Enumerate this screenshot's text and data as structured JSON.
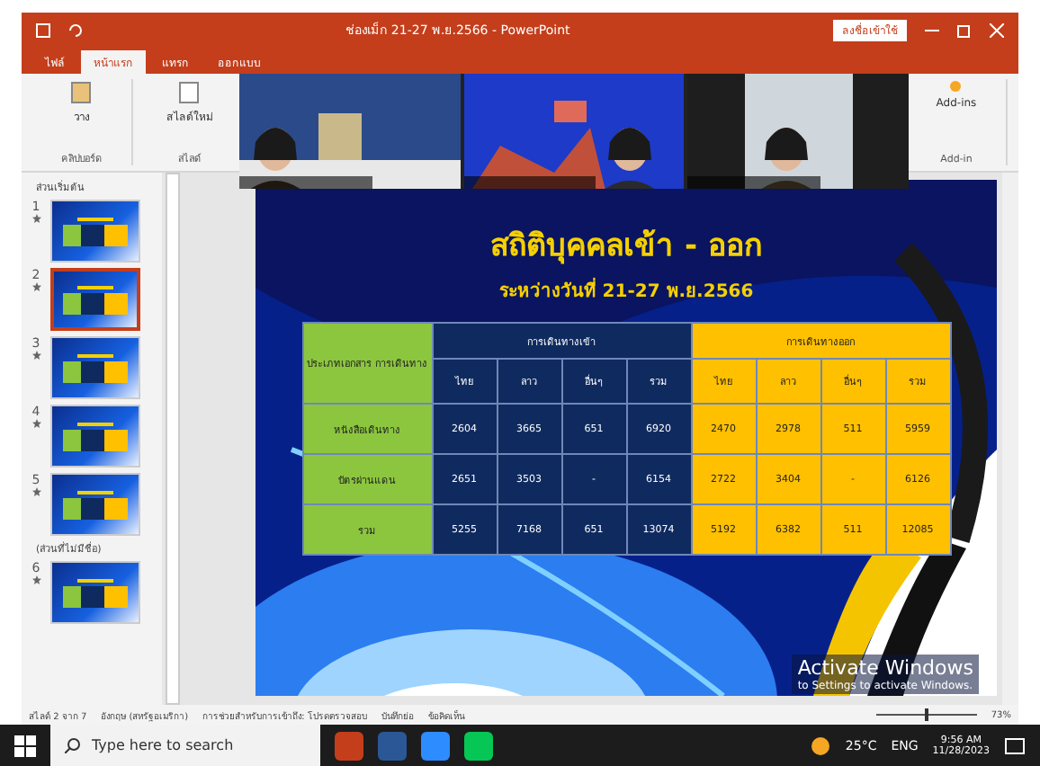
{
  "window": {
    "title": "ช่องเม็ก 21-27 พ.ย.2566  -  PowerPoint",
    "signin_button": "ลงชื่อเข้าใช้"
  },
  "ribbon": {
    "tabs": [
      {
        "label": "ไฟล์",
        "selected": false
      },
      {
        "label": "หน้าแรก",
        "selected": true
      },
      {
        "label": "แทรก",
        "selected": false
      },
      {
        "label": "ออกแบบ",
        "selected": false
      }
    ],
    "groups": [
      {
        "label": "คลิปบอร์ด",
        "button": "วาง"
      },
      {
        "label": "สไลด์",
        "button": "สไลด์ใหม่"
      }
    ],
    "addins": {
      "button": "Add-ins",
      "label": "Add-in"
    }
  },
  "slides_panel": {
    "sections": [
      {
        "title": "ส่วนเริ่มต้น",
        "slides": [
          {
            "number": "1",
            "selected": false
          },
          {
            "number": "2",
            "selected": true
          },
          {
            "number": "3",
            "selected": false
          },
          {
            "number": "4",
            "selected": false
          },
          {
            "number": "5",
            "selected": false
          }
        ]
      },
      {
        "title": "(ส่วนที่ไม่มีชื่อ)",
        "slides": [
          {
            "number": "6",
            "selected": false
          }
        ]
      }
    ]
  },
  "slide": {
    "title": "สถิติบุคคลเข้า - ออก",
    "subtitle": "ระหว่างวันที่ 21-27 พ.ย.2566",
    "table": {
      "corner": "ประเภทเอกสาร การเดินทาง",
      "groups": [
        {
          "label": "การเดินทางเข้า",
          "color": "#0f2a5e",
          "columns": [
            "ไทย",
            "ลาว",
            "อื่นๆ",
            "รวม"
          ]
        },
        {
          "label": "การเดินทางออก",
          "color": "#ffc000",
          "columns": [
            "ไทย",
            "ลาว",
            "อื่นๆ",
            "รวม"
          ]
        }
      ],
      "rows": [
        {
          "label": "หนังสือเดินทาง",
          "cells": [
            "2604",
            "3665",
            "651",
            "6920",
            "2470",
            "2978",
            "511",
            "5959"
          ]
        },
        {
          "label": "บัตรผ่านแดน",
          "cells": [
            "2651",
            "3503",
            "-",
            "6154",
            "2722",
            "3404",
            "-",
            "6126"
          ]
        },
        {
          "label": "รวม",
          "cells": [
            "5255",
            "7168",
            "651",
            "13074",
            "5192",
            "6382",
            "511",
            "12085"
          ]
        }
      ]
    }
  },
  "activation": {
    "title": "Activate Windows",
    "message": "to Settings to activate Windows."
  },
  "status_bar": {
    "slide_info": "สไลด์ 2 จาก 7",
    "language": "อังกฤษ (สหรัฐอเมริกา)",
    "accessibility": "การช่วยสำหรับการเข้าถึง: โปรดตรวจสอบ",
    "notes": "บันทึกย่อ",
    "comments": "ข้อคิดเห็น",
    "zoom": {
      "level": 0.5,
      "reading": "73%"
    }
  },
  "taskbar": {
    "search_placeholder": "Type here to search",
    "weather": "25°C",
    "language": "ENG",
    "time": "9:56 AM",
    "date": "11/28/2023"
  }
}
